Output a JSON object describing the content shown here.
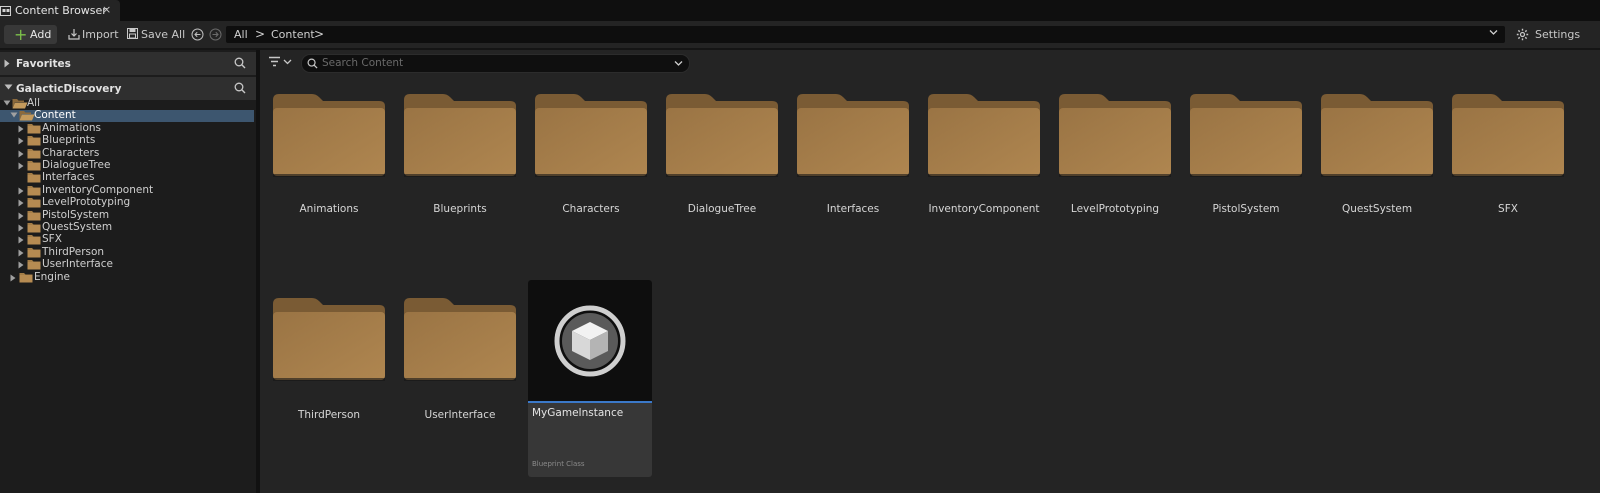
{
  "tab": {
    "title": "Content Browser",
    "close": "×"
  },
  "toolbar": {
    "add_icon": "+",
    "add_label": "Add",
    "import_label": "Import",
    "save_all_label": "Save All",
    "settings_label": "Settings",
    "add_color": "#7cc04a"
  },
  "breadcrumb": {
    "items": [
      "All",
      "Content"
    ],
    "separator": ">"
  },
  "sidebar": {
    "favorites_label": "Favorites",
    "project_label": "GalacticDiscovery",
    "tree": [
      {
        "label": "All",
        "level": 0,
        "expanded": true
      },
      {
        "label": "Content",
        "level": 1,
        "expanded": true,
        "selected": true
      },
      {
        "label": "Animations",
        "level": 2
      },
      {
        "label": "Blueprints",
        "level": 2
      },
      {
        "label": "Characters",
        "level": 2
      },
      {
        "label": "DialogueTree",
        "level": 2
      },
      {
        "label": "Interfaces",
        "level": 2,
        "leaf": true
      },
      {
        "label": "InventoryComponent",
        "level": 2
      },
      {
        "label": "LevelPrototyping",
        "level": 2
      },
      {
        "label": "PistolSystem",
        "level": 2
      },
      {
        "label": "QuestSystem",
        "level": 2
      },
      {
        "label": "SFX",
        "level": 2
      },
      {
        "label": "ThirdPerson",
        "level": 2
      },
      {
        "label": "UserInterface",
        "level": 2
      },
      {
        "label": "Engine",
        "level": 1
      }
    ],
    "selected_color": "#3d566f"
  },
  "content": {
    "search_placeholder": "Search Content",
    "folders": [
      "Animations",
      "Blueprints",
      "Characters",
      "DialogueTree",
      "Interfaces",
      "InventoryComponent",
      "LevelPrototyping",
      "PistolSystem",
      "QuestSystem",
      "SFX",
      "ThirdPerson",
      "UserInterface"
    ],
    "asset": {
      "name": "MyGameInstance",
      "type": "Blueprint Class",
      "icon": "cube-icon",
      "accent": "#3b79c9"
    },
    "folder_color": "#a47d47"
  }
}
